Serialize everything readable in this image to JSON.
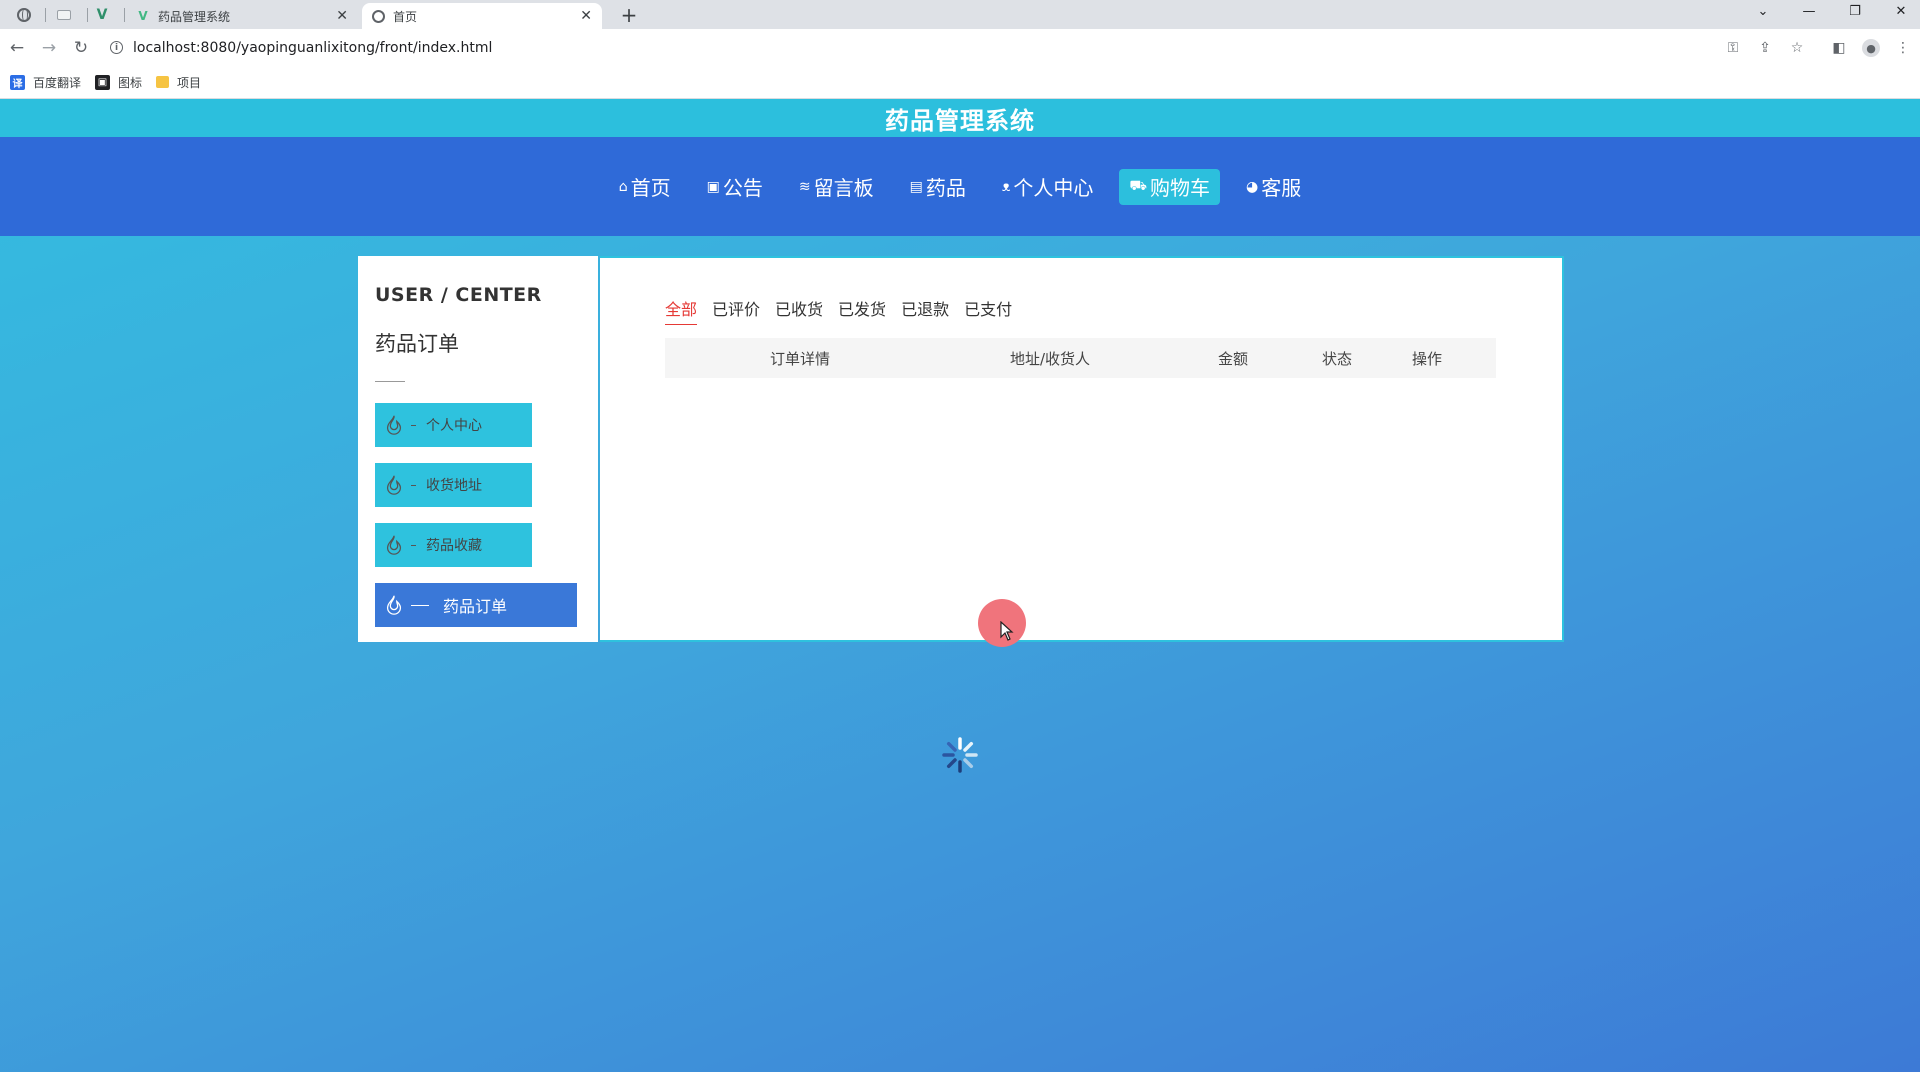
{
  "browser": {
    "tabs": [
      {
        "title": "药品管理系统",
        "close": "✕"
      },
      {
        "title": "首页",
        "close": "✕"
      }
    ],
    "new_tab": "+",
    "url": "localhost:8080/yaopinguanlixitong/front/index.html",
    "bookmarks": [
      {
        "label": "百度翻译",
        "icon": "translate-icon",
        "color": "#2b6de5",
        "glyph": "译"
      },
      {
        "label": "图标",
        "icon": "image-icon",
        "color": "#202124",
        "glyph": "▣"
      },
      {
        "label": "项目",
        "icon": "folder-icon",
        "color": "#f6c443",
        "glyph": ""
      }
    ]
  },
  "header": {
    "title": "药品管理系统"
  },
  "nav": {
    "items": [
      {
        "label": "首页",
        "icon": "home-icon",
        "glyph": "⌂"
      },
      {
        "label": "公告",
        "icon": "notice-icon",
        "glyph": "▣"
      },
      {
        "label": "留言板",
        "icon": "message-icon",
        "glyph": "≋"
      },
      {
        "label": "药品",
        "icon": "medicine-icon",
        "glyph": "▤"
      },
      {
        "label": "个人中心",
        "icon": "user-icon",
        "glyph": "ᴥ"
      },
      {
        "label": "购物车",
        "icon": "cart-icon",
        "glyph": "⛟"
      },
      {
        "label": "客服",
        "icon": "service-icon",
        "glyph": "◕"
      }
    ],
    "active_index": 5
  },
  "sidebar": {
    "title_en": "USER / CENTER",
    "title_cn": "药品订单",
    "items": [
      {
        "label": "个人中心",
        "icon": "flame-icon"
      },
      {
        "label": "收货地址",
        "icon": "flame-icon"
      },
      {
        "label": "药品收藏",
        "icon": "flame-icon"
      },
      {
        "label": "药品订单",
        "icon": "flame-icon"
      }
    ],
    "active_index": 3
  },
  "orders": {
    "tabs": [
      "全部",
      "已评价",
      "已收货",
      "已发货",
      "已退款",
      "已支付"
    ],
    "active_tab": 0,
    "columns": [
      "订单详情",
      "地址/收货人",
      "金额",
      "状态",
      "操作"
    ]
  },
  "colors": {
    "header": "#2cbfdd",
    "nav": "#2f6ad8",
    "accent": "#2ec2de",
    "active_side": "#3a78d8",
    "active_tab": "#e53935"
  }
}
